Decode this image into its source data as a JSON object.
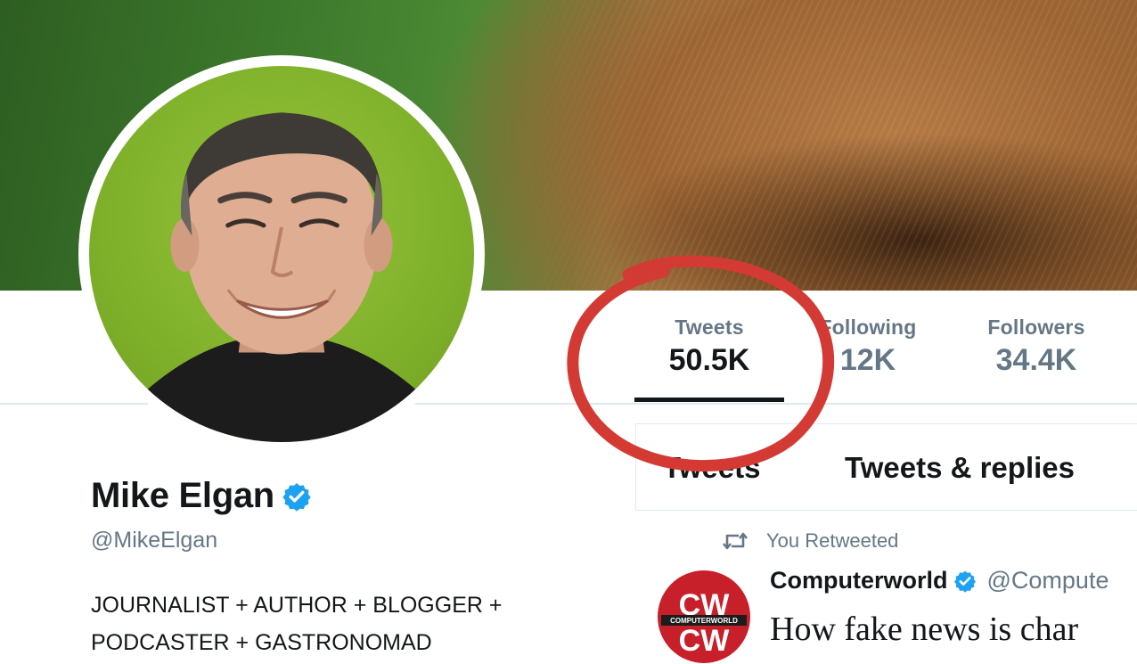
{
  "profile": {
    "name": "Mike Elgan",
    "handle": "@MikeElgan",
    "bio_line1": "JOURNALIST + AUTHOR + BLOGGER +",
    "bio_line2": "PODCASTER + GASTRONOMAD",
    "verified": true
  },
  "stats": {
    "tweets_label": "Tweets",
    "tweets_value": "50.5K",
    "following_label": "Following",
    "following_value": "12K",
    "followers_label": "Followers",
    "followers_value": "34.4K",
    "active": "Tweets"
  },
  "tabs": {
    "tweets": "Tweets",
    "replies": "Tweets & replies"
  },
  "tweet": {
    "retweet_note": "You Retweeted",
    "author": "Computerworld",
    "handle": "@Compute",
    "text": "How fake news is char",
    "avatar_letters": "CW",
    "avatar_caption": "COMPUTERWORLD"
  },
  "icons": {
    "verified": "verified-badge-icon",
    "retweet": "retweet-icon"
  },
  "colors": {
    "verified_blue": "#1da1f2",
    "muted_text": "#657786",
    "annotation_red": "#d43a34",
    "cw_red": "#c8202a"
  }
}
